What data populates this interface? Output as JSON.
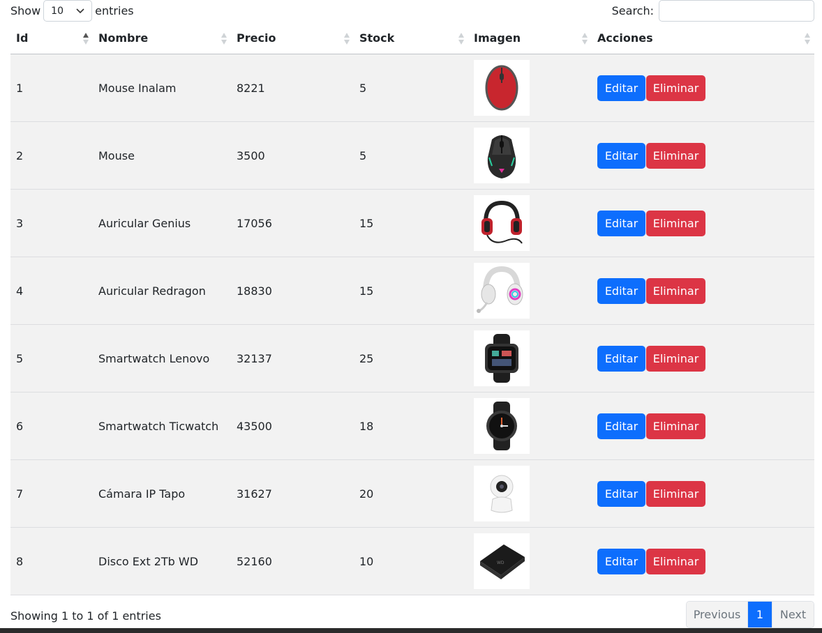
{
  "controls": {
    "show_label": "Show",
    "length_value": "10",
    "entries_label": "entries",
    "search_label": "Search:",
    "search_value": ""
  },
  "table": {
    "headers": [
      "Id",
      "Nombre",
      "Precio",
      "Stock",
      "Imagen",
      "Acciones"
    ],
    "rows": [
      {
        "id": "1",
        "nombre": "Mouse Inalam",
        "precio": "8221",
        "stock": "5",
        "image": "red-mouse-icon"
      },
      {
        "id": "2",
        "nombre": "Mouse",
        "precio": "3500",
        "stock": "5",
        "image": "gaming-mouse-icon"
      },
      {
        "id": "3",
        "nombre": "Auricular Genius",
        "precio": "17056",
        "stock": "15",
        "image": "headset-red-icon"
      },
      {
        "id": "4",
        "nombre": "Auricular Redragon",
        "precio": "18830",
        "stock": "15",
        "image": "headset-white-icon"
      },
      {
        "id": "5",
        "nombre": "Smartwatch Lenovo",
        "precio": "32137",
        "stock": "25",
        "image": "smartwatch-square-icon"
      },
      {
        "id": "6",
        "nombre": "Smartwatch Ticwatch",
        "precio": "43500",
        "stock": "18",
        "image": "smartwatch-round-icon"
      },
      {
        "id": "7",
        "nombre": "Cámara IP Tapo",
        "precio": "31627",
        "stock": "20",
        "image": "ip-camera-icon"
      },
      {
        "id": "8",
        "nombre": "Disco Ext 2Tb WD",
        "precio": "52160",
        "stock": "10",
        "image": "external-drive-icon"
      }
    ],
    "edit_label": "Editar",
    "delete_label": "Eliminar"
  },
  "footer": {
    "info": "Showing 1 to 1 of 1 entries",
    "previous": "Previous",
    "current_page": "1",
    "next": "Next"
  },
  "colors": {
    "primary": "#0d6efd",
    "danger": "#dc3545",
    "row_bg": "#f2f2f2"
  }
}
